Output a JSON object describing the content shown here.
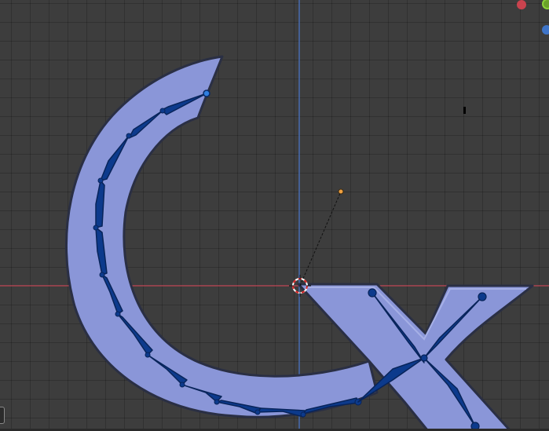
{
  "viewport": {
    "grid": true,
    "colors": {
      "background": "#3d3d3d",
      "x_axis": "#c24a58",
      "y_axis": "#4a74c4",
      "mesh_fill": "#8a96d8",
      "mesh_edge": "#2a2f44",
      "bone_fill": "#0c3a8c",
      "bone_outline": "#08245a",
      "selected_bone": "#2f7fe0",
      "light_point": "#f0a040"
    },
    "gizmo": {
      "x_color": "#c9434e",
      "y_color": "#6aa12a",
      "z_color": "#3e74c8"
    },
    "icons": [
      "3d-cursor-icon",
      "light-point-icon"
    ]
  }
}
